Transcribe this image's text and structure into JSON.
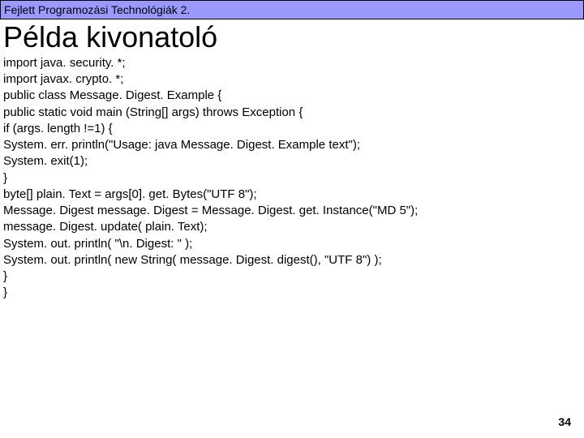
{
  "header": {
    "course_title": "Fejlett Programozási Technológiák 2."
  },
  "slide": {
    "title": "Példa kivonatoló"
  },
  "code": {
    "lines": [
      "import java. security. *;",
      "import javax. crypto. *;",
      "public class Message. Digest. Example {",
      "public static void main (String[] args) throws Exception {",
      "if (args. length !=1) {",
      "System. err. println(\"Usage: java Message. Digest. Example text\");",
      "System. exit(1);",
      "}",
      "byte[] plain. Text = args[0]. get. Bytes(\"UTF 8\");",
      "Message. Digest message. Digest = Message. Digest. get. Instance(\"MD 5\");",
      "message. Digest. update( plain. Text);",
      "System. out. println( \"\\n. Digest: \" );",
      "System. out. println( new String( message. Digest. digest(), \"UTF 8\") );",
      "}",
      "}"
    ]
  },
  "footer": {
    "page_number": "34"
  }
}
